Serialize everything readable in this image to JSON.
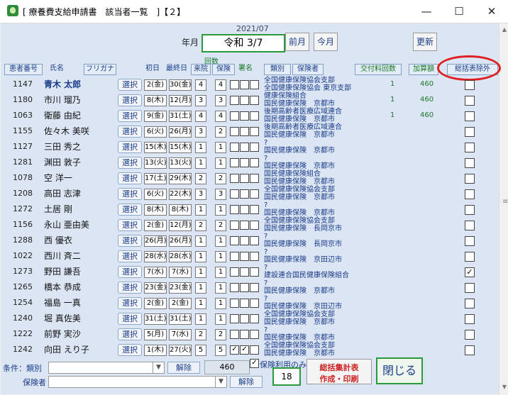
{
  "window": {
    "title": "[ 療養費支給申請書　該当者一覧　]【２】",
    "minimize": "—",
    "maximize": "☐",
    "close": "✕"
  },
  "header": {
    "year_month": "2021/07",
    "nengetsu_label": "年月",
    "date_display": "令和 3/7",
    "prev_month": "前月",
    "this_month": "今月",
    "refresh": "更新"
  },
  "columns": {
    "patient_no": "患者番号",
    "name": "氏名",
    "furigana": "フリガナ",
    "first_day": "初日",
    "last_day": "最終日",
    "count_group": "回数",
    "visits": "来院",
    "insurance": "保険",
    "signature": "署名",
    "category": "類別",
    "insurer": "保険者",
    "delivery_count": "交付料回数",
    "addition": "加算額",
    "summary_exclude": "総括表除外"
  },
  "rows": [
    {
      "no": "1147",
      "name": "青木 太郎",
      "first": "2(金)",
      "last": "30(金)",
      "visits": "4",
      "ins": "4",
      "cb": [
        "",
        "",
        ""
      ],
      "info1": "全国健康保険協会支部",
      "info2": "全国健康保険協会 東京支部",
      "kai": "1",
      "kas": "460",
      "ex": "",
      "bold": true
    },
    {
      "no": "1180",
      "name": "市川 瑠乃",
      "first": "8(木)",
      "last": "12(月)",
      "visits": "3",
      "ins": "3",
      "cb": [
        "",
        "",
        ""
      ],
      "info1": "健康保険組合",
      "info2": "国民健康保険　京都市",
      "kai": "1",
      "kas": "460",
      "ex": ""
    },
    {
      "no": "1063",
      "name": "衛藤 由紀",
      "first": "9(金)",
      "last": "31(土)",
      "visits": "4",
      "ins": "4",
      "cb": [
        "",
        "",
        ""
      ],
      "info1": "後期高齢者医療広域連合",
      "info2": "国民健康保険　京都市",
      "kai": "1",
      "kas": "460",
      "ex": ""
    },
    {
      "no": "1155",
      "name": "佐々木 美咲",
      "first": "6(火)",
      "last": "26(月)",
      "visits": "3",
      "ins": "2",
      "cb": [
        "",
        "",
        ""
      ],
      "info1": "後期高齢者医療広域連合",
      "info2": "国民健康保険　京都市",
      "kai": "",
      "kas": "",
      "ex": ""
    },
    {
      "no": "1127",
      "name": "三田 秀之",
      "first": "15(木)",
      "last": "15(木)",
      "visits": "1",
      "ins": "1",
      "cb": [
        "",
        "",
        ""
      ],
      "info1": "?",
      "info2": "国民健康保険　京都市",
      "kai": "",
      "kas": "",
      "ex": ""
    },
    {
      "no": "1281",
      "name": "渊田 敦子",
      "first": "13(火)",
      "last": "13(火)",
      "visits": "1",
      "ins": "1",
      "cb": [
        "",
        "",
        ""
      ],
      "info1": "?",
      "info2": "国民健康保険　京都市",
      "kai": "",
      "kas": "",
      "ex": ""
    },
    {
      "no": "1078",
      "name": "空 洋一",
      "first": "17(土)",
      "last": "29(木)",
      "visits": "2",
      "ins": "2",
      "cb": [
        "",
        "",
        ""
      ],
      "info1": "国民健康保険組合",
      "info2": "国民健康保険　京都市",
      "kai": "",
      "kas": "",
      "ex": ""
    },
    {
      "no": "1208",
      "name": "高田 志津",
      "first": "6(火)",
      "last": "22(木)",
      "visits": "3",
      "ins": "3",
      "cb": [
        "",
        "",
        ""
      ],
      "info1": "全国健康保険協会支部",
      "info2": "国民健康保険　京都市",
      "kai": "",
      "kas": "",
      "ex": ""
    },
    {
      "no": "1272",
      "name": "土居 剛",
      "first": "8(木)",
      "last": "8(木)",
      "visits": "1",
      "ins": "1",
      "cb": [
        "",
        "",
        ""
      ],
      "info1": "?",
      "info2": "国民健康保険　京都市",
      "kai": "",
      "kas": "",
      "ex": ""
    },
    {
      "no": "1156",
      "name": "永山 亜由美",
      "first": "2(金)",
      "last": "12(月)",
      "visits": "2",
      "ins": "2",
      "cb": [
        "",
        "",
        ""
      ],
      "info1": "全国健康保険協会支部",
      "info2": "国民健康保険　長岡京市",
      "kai": "",
      "kas": "",
      "ex": ""
    },
    {
      "no": "1288",
      "name": "西 優衣",
      "first": "26(月)",
      "last": "26(月)",
      "visits": "1",
      "ins": "1",
      "cb": [
        "",
        "",
        ""
      ],
      "info1": "?",
      "info2": "国民健康保険　長岡京市",
      "kai": "",
      "kas": "",
      "ex": ""
    },
    {
      "no": "1022",
      "name": "西川 斉二",
      "first": "28(水)",
      "last": "28(水)",
      "visits": "1",
      "ins": "1",
      "cb": [
        "",
        "",
        ""
      ],
      "info1": "?",
      "info2": "国民健康保険　京田辺市",
      "kai": "",
      "kas": "",
      "ex": ""
    },
    {
      "no": "1273",
      "name": "野田 謙吾",
      "first": "7(水)",
      "last": "7(水)",
      "visits": "1",
      "ins": "1",
      "cb": [
        "",
        "",
        ""
      ],
      "info1": "?",
      "info2": "建設連合国民健康保険組合",
      "kai": "",
      "kas": "",
      "ex": "✓"
    },
    {
      "no": "1265",
      "name": "橋本 恭成",
      "first": "23(金)",
      "last": "23(金)",
      "visits": "1",
      "ins": "1",
      "cb": [
        "",
        "",
        ""
      ],
      "info1": "?",
      "info2": "国民健康保険　京都市",
      "kai": "",
      "kas": "",
      "ex": ""
    },
    {
      "no": "1254",
      "name": "福島 一真",
      "first": "2(金)",
      "last": "2(金)",
      "visits": "1",
      "ins": "1",
      "cb": [
        "",
        "",
        ""
      ],
      "info1": "?",
      "info2": "国民健康保険　京田辺市",
      "kai": "",
      "kas": "",
      "ex": ""
    },
    {
      "no": "1240",
      "name": "堀 真佐美",
      "first": "31(土)",
      "last": "31(土)",
      "visits": "1",
      "ins": "1",
      "cb": [
        "",
        "",
        ""
      ],
      "info1": "全国健康保険協会支部",
      "info2": "国民健康保険　京都市",
      "kai": "",
      "kas": "",
      "ex": ""
    },
    {
      "no": "1222",
      "name": "前野 実沙",
      "first": "5(月)",
      "last": "7(水)",
      "visits": "2",
      "ins": "2",
      "cb": [
        "",
        "",
        ""
      ],
      "info1": "?",
      "info2": "国民健康保険　京都市",
      "kai": "",
      "kas": "",
      "ex": ""
    },
    {
      "no": "1242",
      "name": "向田 えり子",
      "first": "1(木)",
      "last": "27(火)",
      "visits": "5",
      "ins": "5",
      "cb": [
        "✓",
        "✓",
        ""
      ],
      "info1": "全国健康保険協会支部",
      "info2": "国民健康保険　京都市",
      "kai": "",
      "kas": "",
      "ex": ""
    }
  ],
  "select_label": "選択",
  "footer": {
    "condition_label": "条件：類別",
    "insurer_label": "保険者",
    "clear1": "解除",
    "clear2": "解除",
    "total": "460",
    "insurance_only_label": "保険利用のみ",
    "insurance_only_checked": "✓",
    "count": "18",
    "print_line1": "総括集計表",
    "print_line2": "作成・印刷",
    "close": "閉じる"
  }
}
